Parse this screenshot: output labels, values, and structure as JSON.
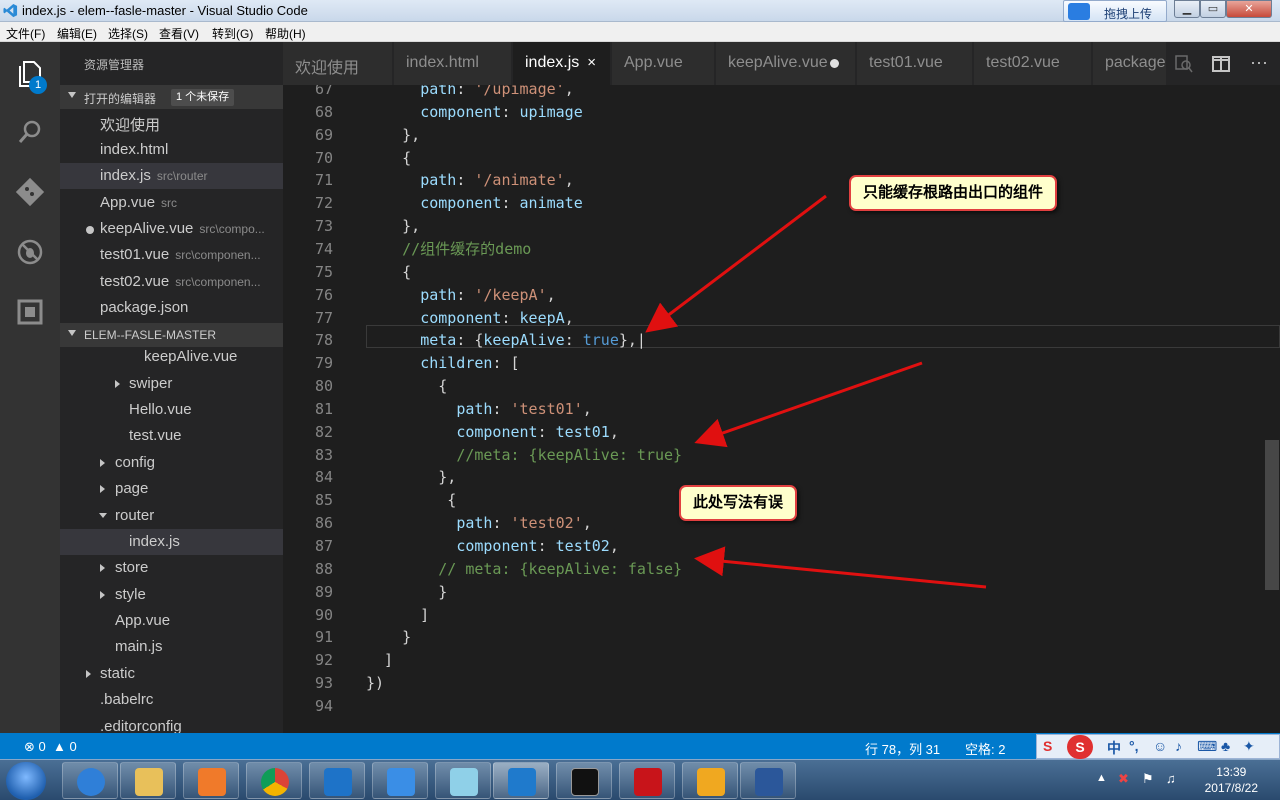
{
  "window": {
    "title": "index.js - elem--fasle-master - Visual Studio Code",
    "cloud_button": "拖拽上传"
  },
  "menu": [
    "文件(F)",
    "编辑(E)",
    "选择(S)",
    "查看(V)",
    "转到(G)",
    "帮助(H)"
  ],
  "activity": {
    "explorer_badge": "1"
  },
  "sidebar": {
    "title": "资源管理器",
    "open_editors_label": "打开的编辑器",
    "unsaved_badge": "1 个未保存",
    "open_editors": [
      {
        "name": "欢迎使用",
        "path": ""
      },
      {
        "name": "index.html",
        "path": ""
      },
      {
        "name": "index.js",
        "path": "src\\router"
      },
      {
        "name": "App.vue",
        "path": "src"
      },
      {
        "name": "keepAlive.vue",
        "path": "src\\compo..."
      },
      {
        "name": "test01.vue",
        "path": "src\\componen..."
      },
      {
        "name": "test02.vue",
        "path": "src\\componen..."
      },
      {
        "name": "package.json",
        "path": ""
      }
    ],
    "project_label": "ELEM--FASLE-MASTER",
    "tree": [
      "keepAlive.vue",
      "swiper",
      "Hello.vue",
      "test.vue",
      "config",
      "page",
      "router",
      "index.js",
      "store",
      "style",
      "App.vue",
      "main.js",
      "static",
      ".babelrc",
      ".editorconfig"
    ]
  },
  "tabs": [
    "欢迎使用",
    "index.html",
    "index.js",
    "App.vue",
    "keepAlive.vue",
    "test01.vue",
    "test02.vue",
    "package"
  ],
  "tab_close": "×",
  "editor": {
    "lines": [
      {
        "n": "67",
        "parts": [
          [
            "p",
            "      "
          ],
          [
            "k",
            "path"
          ],
          [
            "p",
            ": "
          ],
          [
            "s",
            "'/upimage'"
          ],
          [
            "p",
            ","
          ]
        ]
      },
      {
        "n": "68",
        "parts": [
          [
            "p",
            "      "
          ],
          [
            "k",
            "component"
          ],
          [
            "p",
            ": "
          ],
          [
            "k",
            "upimage"
          ]
        ]
      },
      {
        "n": "69",
        "parts": [
          [
            "p",
            "    },"
          ]
        ]
      },
      {
        "n": "70",
        "parts": [
          [
            "p",
            "    {"
          ]
        ]
      },
      {
        "n": "71",
        "parts": [
          [
            "p",
            "      "
          ],
          [
            "k",
            "path"
          ],
          [
            "p",
            ": "
          ],
          [
            "s",
            "'/animate'"
          ],
          [
            "p",
            ","
          ]
        ]
      },
      {
        "n": "72",
        "parts": [
          [
            "p",
            "      "
          ],
          [
            "k",
            "component"
          ],
          [
            "p",
            ": "
          ],
          [
            "k",
            "animate"
          ]
        ]
      },
      {
        "n": "73",
        "parts": [
          [
            "p",
            "    },"
          ]
        ]
      },
      {
        "n": "74",
        "parts": [
          [
            "p",
            "    "
          ],
          [
            "c",
            "//组件缓存的demo"
          ]
        ]
      },
      {
        "n": "75",
        "parts": [
          [
            "p",
            "    {"
          ]
        ]
      },
      {
        "n": "76",
        "parts": [
          [
            "p",
            "      "
          ],
          [
            "k",
            "path"
          ],
          [
            "p",
            ": "
          ],
          [
            "s",
            "'/keepA'"
          ],
          [
            "p",
            ","
          ]
        ]
      },
      {
        "n": "77",
        "parts": [
          [
            "p",
            "      "
          ],
          [
            "k",
            "component"
          ],
          [
            "p",
            ": "
          ],
          [
            "k",
            "keepA"
          ],
          [
            "p",
            ","
          ]
        ]
      },
      {
        "n": "78",
        "parts": [
          [
            "p",
            "      "
          ],
          [
            "k",
            "meta"
          ],
          [
            "p",
            ": {"
          ],
          [
            "k",
            "keepAlive"
          ],
          [
            "p",
            ": "
          ],
          [
            "b",
            "true"
          ],
          [
            "p",
            "},|"
          ]
        ]
      },
      {
        "n": "79",
        "parts": [
          [
            "p",
            "      "
          ],
          [
            "k",
            "children"
          ],
          [
            "p",
            ": ["
          ]
        ]
      },
      {
        "n": "80",
        "parts": [
          [
            "p",
            "        {"
          ]
        ]
      },
      {
        "n": "81",
        "parts": [
          [
            "p",
            "          "
          ],
          [
            "k",
            "path"
          ],
          [
            "p",
            ": "
          ],
          [
            "s",
            "'test01'"
          ],
          [
            "p",
            ","
          ]
        ]
      },
      {
        "n": "82",
        "parts": [
          [
            "p",
            "          "
          ],
          [
            "k",
            "component"
          ],
          [
            "p",
            ": "
          ],
          [
            "k",
            "test01"
          ],
          [
            "p",
            ","
          ]
        ]
      },
      {
        "n": "83",
        "parts": [
          [
            "p",
            "          "
          ],
          [
            "c",
            "//meta: {keepAlive: true}"
          ]
        ]
      },
      {
        "n": "84",
        "parts": [
          [
            "p",
            "        },"
          ]
        ]
      },
      {
        "n": "85",
        "parts": [
          [
            "p",
            "         {"
          ]
        ]
      },
      {
        "n": "86",
        "parts": [
          [
            "p",
            "          "
          ],
          [
            "k",
            "path"
          ],
          [
            "p",
            ": "
          ],
          [
            "s",
            "'test02'"
          ],
          [
            "p",
            ","
          ]
        ]
      },
      {
        "n": "87",
        "parts": [
          [
            "p",
            "          "
          ],
          [
            "k",
            "component"
          ],
          [
            "p",
            ": "
          ],
          [
            "k",
            "test02"
          ],
          [
            "p",
            ","
          ]
        ]
      },
      {
        "n": "88",
        "parts": [
          [
            "p",
            "        "
          ],
          [
            "c",
            "// meta: {keepAlive: false}"
          ]
        ]
      },
      {
        "n": "89",
        "parts": [
          [
            "p",
            "        }"
          ]
        ]
      },
      {
        "n": "90",
        "parts": [
          [
            "p",
            "      ]"
          ]
        ]
      },
      {
        "n": "91",
        "parts": [
          [
            "p",
            "    }"
          ]
        ]
      },
      {
        "n": "92",
        "parts": [
          [
            "p",
            "  ]"
          ]
        ]
      },
      {
        "n": "93",
        "parts": [
          [
            "p",
            "})"
          ]
        ]
      },
      {
        "n": "94",
        "parts": [
          [
            "p",
            ""
          ]
        ]
      }
    ]
  },
  "annotations": {
    "callout_1": "只能缓存根路由出口的组件",
    "callout_2": "此处写法有误"
  },
  "status": {
    "errors": "0",
    "warnings": "0",
    "position": "行 78，列 31",
    "spaces": "空格: 2"
  },
  "ime": {
    "mode": "中"
  },
  "clock": {
    "time": "13:39",
    "date": "2017/8/22"
  },
  "colors": {
    "accent": "#007acc",
    "annotation_arrow": "#e01010"
  }
}
